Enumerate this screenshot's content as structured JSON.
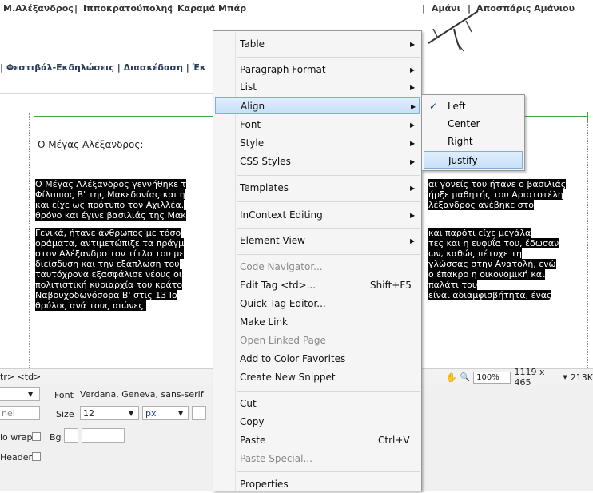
{
  "top_nav": {
    "links": [
      "Μ.Αλέξανδρος",
      "Ιπποκρατούπολης",
      "Καραμά Μπάρ",
      "Αμάνι",
      "Αποσπάρις Αμάνιου"
    ],
    "separators": [
      "|",
      "|",
      "|",
      "|"
    ]
  },
  "sub_nav": {
    "text": "| Φεστιβάλ-Εκδηλώσεις  | Διασκέδαση  | Έκ"
  },
  "content": {
    "heading": "Ο Μέγας Αλέξανδρος:",
    "para1_left": [
      "Ο Μέγας Αλέξανδρος γεννήθηκε τ",
      "Φίλιππος Β' της Μακεδονίας και η",
      "και είχε ως πρότυπο τον Αχιλλέα.",
      "θρόνο και έγινε βασιλιάς της Μακ"
    ],
    "para1_right": [
      "αι γονείς του ήτανε ο βασιλιάς",
      "ήρξε μαθητής του Αριστοτέλη",
      "λέξανδρος ανέβηκε στο",
      ""
    ],
    "para2_left": [
      "Γενικά, ήτανε άνθρωπος με τόσο",
      "οράματα, αντιμετώπιζε τα πράγμ",
      "στον Αλέξανδρο τον τίτλο του με",
      "διείσδυση και την εξάπλωση του",
      "ταυτόχρονα εξασφάλισε νέους οι",
      "πολιτιστική κυριαρχία του κράτο",
      "Ναβουχοδωνόσορα Β' στις 13 Ιο",
      "θρύλος ανά τους αιώνες."
    ],
    "para2_right": [
      " και παρότι είχε μεγάλα",
      "τες και η ευφυΐα του, έδωσαν",
      "ων, καθώς πέτυχε τη",
      "γλώσσας στην Ανατολή, ενώ",
      "ο έπακρο η οικονομική και",
      "παλάτι του",
      "είναι αδιαμφισβήτητα, ένας",
      ""
    ]
  },
  "status_bar": {
    "tag_path": "tr> <td>",
    "zoom": "100%",
    "dimensions": "1119 x 465",
    "size": "213K"
  },
  "properties": {
    "font_label": "Font",
    "font_value": "Verdana, Geneva, sans-serif",
    "size_label": "Size",
    "size_value": "12",
    "unit_value": "px",
    "left_field": "nel",
    "no_wrap_label": "lo wrap",
    "bg_label": "Bg",
    "header_label": "Header"
  },
  "context_menu": {
    "items": [
      {
        "label": "Table",
        "submenu": true
      },
      {
        "label": "Paragraph Format",
        "submenu": true
      },
      {
        "label": "List",
        "submenu": true
      },
      {
        "label": "Align",
        "submenu": true,
        "highlighted": true
      },
      {
        "label": "Font",
        "submenu": true
      },
      {
        "label": "Style",
        "submenu": true
      },
      {
        "label": "CSS Styles",
        "submenu": true
      },
      {
        "label": "Templates",
        "submenu": true
      },
      {
        "label": "InContext Editing",
        "submenu": true
      },
      {
        "label": "Element View",
        "submenu": true
      },
      {
        "label": "Code Navigator...",
        "disabled": true
      },
      {
        "label": "Edit Tag <td>...",
        "shortcut": "Shift+F5"
      },
      {
        "label": "Quick Tag Editor..."
      },
      {
        "label": "Make Link"
      },
      {
        "label": "Open Linked Page",
        "disabled": true
      },
      {
        "label": "Add to Color Favorites"
      },
      {
        "label": "Create New Snippet"
      },
      {
        "label": "Cut"
      },
      {
        "label": "Copy"
      },
      {
        "label": "Paste",
        "shortcut": "Ctrl+V"
      },
      {
        "label": "Paste Special...",
        "disabled": true
      },
      {
        "label": "Properties"
      }
    ]
  },
  "align_submenu": {
    "items": [
      {
        "label": "Left",
        "checked": true
      },
      {
        "label": "Center"
      },
      {
        "label": "Right"
      },
      {
        "label": "Justify",
        "highlighted": true
      }
    ],
    "check_glyph": "✓"
  },
  "glyphs": {
    "submenu_arrow": "▶",
    "dropdown_arrow": "▼",
    "hand_tool": "✋",
    "zoom_tool": "🔍"
  }
}
